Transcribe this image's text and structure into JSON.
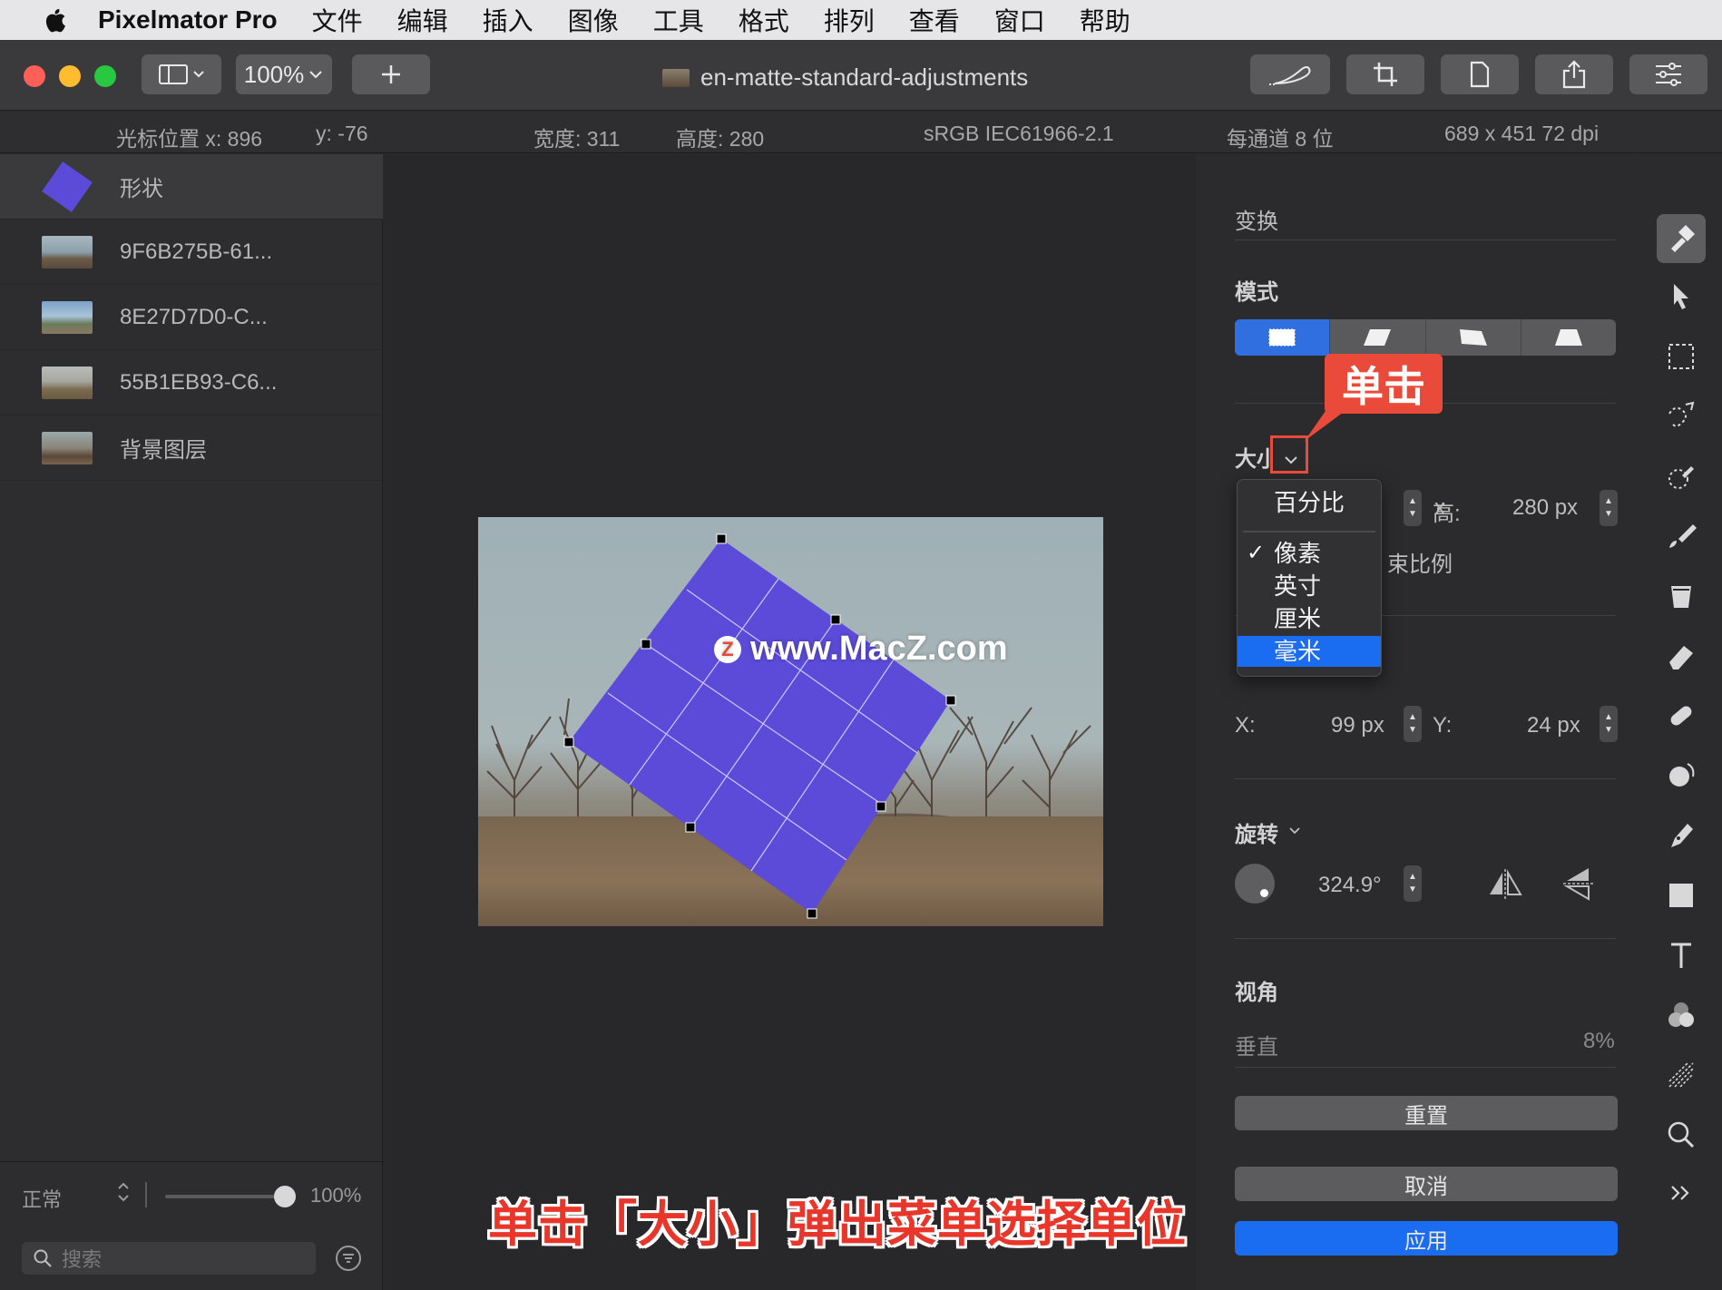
{
  "menubar": {
    "app": "Pixelmator Pro",
    "items": [
      "文件",
      "编辑",
      "插入",
      "图像",
      "工具",
      "格式",
      "排列",
      "查看",
      "窗口",
      "帮助"
    ]
  },
  "toolbar": {
    "zoom": "100%",
    "document_title": "en-matte-standard-adjustments"
  },
  "infobar": {
    "cursor_x": "光标位置 x:  896",
    "cursor_y": "y:  -76",
    "width": "宽度:  311",
    "height": "高度:  280",
    "color_profile": "sRGB IEC61966-2.1",
    "bit_depth": "每通道 8 位",
    "dimensions": "689 x 451 72 dpi"
  },
  "layers": [
    {
      "name": "形状",
      "kind": "shape"
    },
    {
      "name": "9F6B275B-61...",
      "kind": "photo"
    },
    {
      "name": "8E27D7D0-C...",
      "kind": "photo"
    },
    {
      "name": "55B1EB93-C6...",
      "kind": "photo"
    },
    {
      "name": "背景图层",
      "kind": "photo"
    }
  ],
  "sidebar_bottom": {
    "blend_mode": "正常",
    "opacity": "100%",
    "opacity_value": 1.0,
    "search_placeholder": "搜索"
  },
  "canvas": {
    "watermark": "www.MacZ.com",
    "watermark_logo": "Z",
    "caption": "单击「大小」弹出菜单选择单位"
  },
  "panel": {
    "section_transform": "变换",
    "mode_label": "模式",
    "size_label": "大小",
    "height_label": "高:",
    "height_value": "280 px",
    "constrain_label": "束比例",
    "x_label": "X:",
    "x_value": "99 px",
    "y_label": "Y:",
    "y_value": "24 px",
    "rotate_label": "旋转",
    "rotate_value": "324.9°",
    "perspective_label": "视角",
    "vertical_label": "垂直",
    "vertical_value": "8%",
    "reset_button": "重置",
    "cancel_button": "取消",
    "apply_button": "应用"
  },
  "unit_menu": {
    "items": [
      "百分比",
      "像素",
      "英寸",
      "厘米",
      "毫米"
    ],
    "checked": "像素",
    "highlighted": "毫米"
  },
  "callout": "单击",
  "colors": {
    "accent": "#1a6cf0",
    "shape": "#5b4bd8",
    "annotation": "#ea4a3a"
  }
}
